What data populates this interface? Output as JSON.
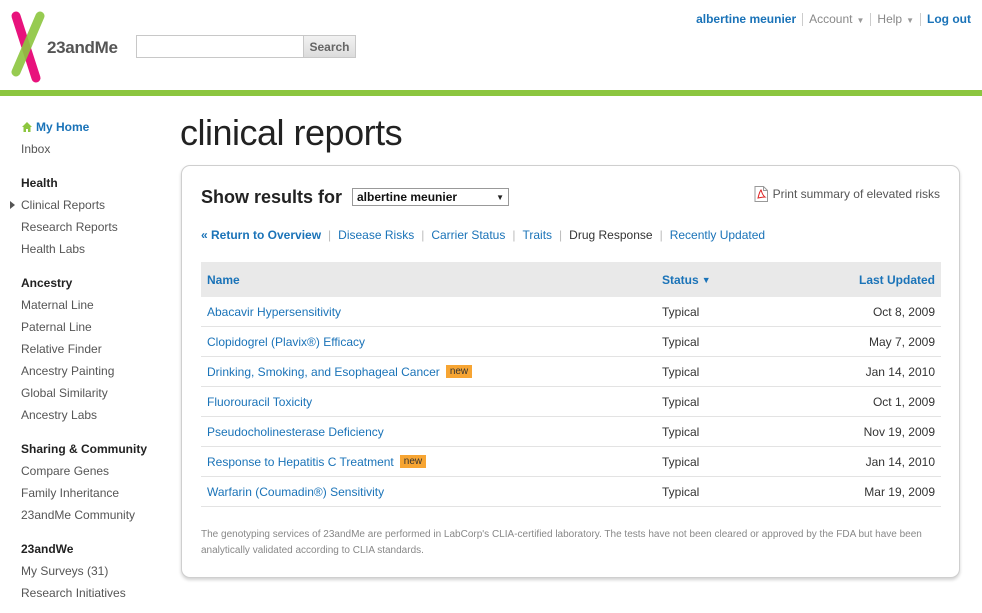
{
  "brand": {
    "name": "23andMe",
    "green": "#8cc63f",
    "pink": "#e8127c",
    "link": "#1a73b8"
  },
  "search": {
    "placeholder": "",
    "button_label": "Search"
  },
  "topnav": {
    "user": "albertine meunier",
    "account": "Account",
    "help": "Help",
    "logout": "Log out"
  },
  "sidebar": {
    "home": "My Home",
    "inbox": "Inbox",
    "sections": [
      {
        "heading": "Health",
        "items": [
          "Clinical Reports",
          "Research Reports",
          "Health Labs"
        ]
      },
      {
        "heading": "Ancestry",
        "items": [
          "Maternal Line",
          "Paternal Line",
          "Relative Finder",
          "Ancestry Painting",
          "Global Similarity",
          "Ancestry Labs"
        ]
      },
      {
        "heading": "Sharing & Community",
        "items": [
          "Compare Genes",
          "Family Inheritance",
          "23andMe Community"
        ]
      },
      {
        "heading": "23andWe",
        "items": [
          "My Surveys (31)",
          "Research Initiatives"
        ]
      }
    ]
  },
  "page": {
    "title": "clinical reports"
  },
  "panel": {
    "show_label": "Show results for",
    "profile": "albertine meunier",
    "print_link": "Print summary of elevated risks",
    "subnav": [
      "« Return to Overview",
      "Disease Risks",
      "Carrier Status",
      "Traits",
      "Drug Response",
      "Recently Updated"
    ],
    "table": {
      "headers": {
        "name": "Name",
        "status": "Status",
        "updated": "Last Updated"
      },
      "new_label": "new",
      "rows": [
        {
          "name": "Abacavir Hypersensitivity",
          "status": "Typical",
          "date": "Oct 8, 2009"
        },
        {
          "name": "Clopidogrel (Plavix®) Efficacy",
          "status": "Typical",
          "date": "May 7, 2009"
        },
        {
          "name": "Drinking, Smoking, and Esophageal Cancer",
          "status": "Typical",
          "date": "Jan 14, 2010"
        },
        {
          "name": "Fluorouracil Toxicity",
          "status": "Typical",
          "date": "Oct 1, 2009"
        },
        {
          "name": "Pseudocholinesterase Deficiency",
          "status": "Typical",
          "date": "Nov 19, 2009"
        },
        {
          "name": "Response to Hepatitis C Treatment",
          "status": "Typical",
          "date": "Jan 14, 2010"
        },
        {
          "name": "Warfarin (Coumadin®) Sensitivity",
          "status": "Typical",
          "date": "Mar 19, 2009"
        }
      ]
    },
    "disclaimer": "The genotyping services of 23andMe are performed in LabCorp's CLIA-certified laboratory. The tests have not been cleared or approved by the FDA but have been analytically validated according to CLIA standards."
  }
}
